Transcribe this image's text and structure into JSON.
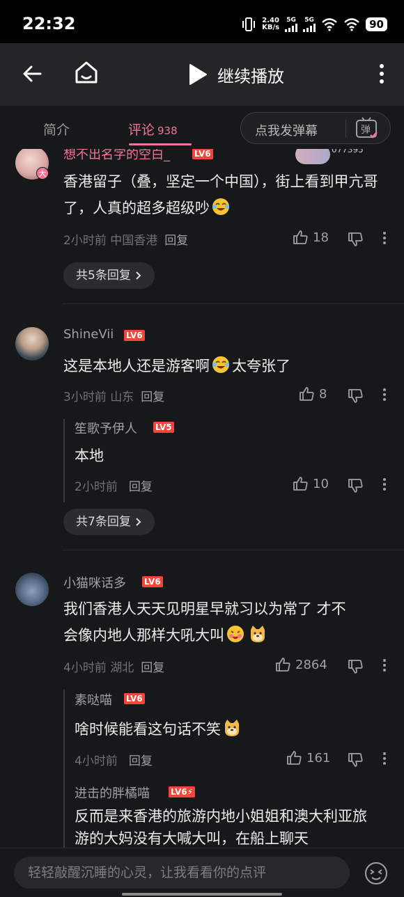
{
  "status_bar": {
    "time": "22:32",
    "net_speed_value": "2.40",
    "net_speed_unit": "KB/s",
    "sig1": "5G",
    "sig2": "5G",
    "battery": "90"
  },
  "nav": {
    "title": "继续播放"
  },
  "tabs": {
    "intro": "简介",
    "comments": "评论",
    "comments_count": "938",
    "danmaku": "点我发弹幕",
    "danmaku_icon_char": "弹"
  },
  "comments": [
    {
      "user": "想不出名字的空白_",
      "level": "LV6",
      "avatar_badge": "大",
      "badge_number": "077395",
      "text_before": "香港留子（叠，坚定一个中国），街上看到甲亢哥了，人真的超多超级吵",
      "text_after": "",
      "time": "2小时前",
      "location": "中国香港",
      "reply": "回复",
      "likes": "18",
      "replies_button": "共5条回复"
    },
    {
      "user": "ShineVii",
      "level": "LV6",
      "text_before": "这是本地人还是游客啊",
      "text_after": "太夸张了",
      "time": "3小时前",
      "location": "山东",
      "reply": "回复",
      "likes": "8",
      "sub_replies": [
        {
          "user": "笙歌予伊人",
          "level": "LV5",
          "text": "本地",
          "time": "2小时前",
          "reply": "回复",
          "likes": "10"
        }
      ],
      "replies_button": "共7条回复"
    },
    {
      "user": "小猫咪话多",
      "level": "LV6",
      "text_line1": "我们香港人天天见明星早就习以为常了 才不",
      "text_line2": "会像内地人那样大吼大叫",
      "time": "4小时前",
      "location": "湖北",
      "reply": "回复",
      "likes": "2864",
      "sub_replies": [
        {
          "user": "素哒喵",
          "level": "LV6",
          "text": "啥时候能看这句话不笑",
          "time": "4小时前",
          "reply": "回复",
          "likes": "161"
        },
        {
          "user": "进击的胖橘喵",
          "level": "LV6⚡",
          "text_line1": "反而是来香港的旅游内地小姐姐和澳大利亚旅",
          "text_line2": "游的大妈没有大喊大叫，在船上聊天"
        }
      ]
    }
  ],
  "input": {
    "placeholder": "轻轻敲醒沉睡的心灵，让我看看你的点评"
  },
  "colors": {
    "accent_pink": "#f3739b",
    "level_red": "#f3453a",
    "background": "#16181a"
  }
}
